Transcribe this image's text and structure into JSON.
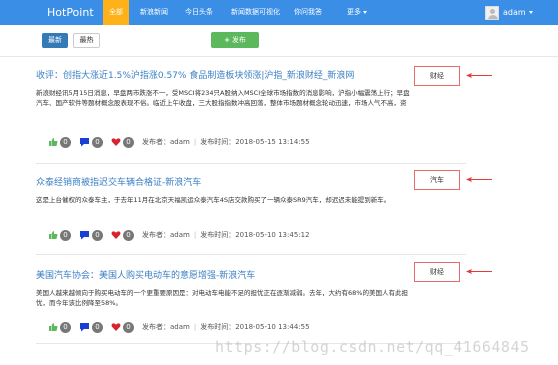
{
  "navbar": {
    "brand": "HotPoint",
    "items": [
      {
        "label": "全部",
        "active": true
      },
      {
        "label": "新浪新闻",
        "active": false
      },
      {
        "label": "今日头条",
        "active": false
      },
      {
        "label": "新闻数据可视化",
        "active": false
      },
      {
        "label": "你问我答",
        "active": false
      },
      {
        "label": "更多",
        "active": false
      }
    ],
    "user": "adam"
  },
  "toolbar": {
    "latest_label": "最新",
    "hottest_label": "最热",
    "publish_label": "发布"
  },
  "posts": [
    {
      "title": "收评：创指大涨近1.5%沪指涨0.57% 食品制造板块领涨|沪指_新浪财经_新浪网",
      "body": "新浪财经讯5月15日消息，早盘两市跌涨不一，受MSCI将234只A股纳入MSCI全球市场指数的消息影响，沪指小幅震荡上行；早盘汽车、国产软件等题材概念股表现不俗。临近上午收盘，三大股指指数冲高回落，整体市场题材概念轮动迅速，市场人气不高，资",
      "likes": "0",
      "comments": "0",
      "hearts": "0",
      "author": "发布者：adam",
      "time": "发布时间：2018-05-15 13:14:55",
      "tag": "财经"
    },
    {
      "title": "众泰经销商被指迟交车辆合格证-新浪汽车",
      "body": "这是上台催权的众泰车主，于去年11月在北京天福凯运众泰汽车4S店交款购买了一辆众泰SR9汽车，却迟迟未能提到新车。",
      "likes": "0",
      "comments": "0",
      "hearts": "0",
      "author": "发布者：adam",
      "time": "发布时间：2018-05-10 13:45:12",
      "tag": "汽车"
    },
    {
      "title": "美国汽车协会：美国人购买电动车的意愿增强-新浪汽车",
      "body": "美国人越来越倾向于购买电动车的一个更重要原因是：对电动车电能不足的担忧正在逐渐减弱。去年，大约有68%的美国人有此担忧，而今年该比例降至58%。",
      "likes": "0",
      "comments": "0",
      "hearts": "0",
      "author": "发布者：adam",
      "time": "发布时间：2018-05-10 13:44:55",
      "tag": "财经"
    }
  ],
  "watermark": "https://blog.csdn.net/qq_41664845",
  "colors": {
    "navbar": "#3a8ee6",
    "active_tab": "#ffb11a",
    "primary_button": "#337ab7",
    "success_button": "#5cb85c",
    "link": "#3b7fc4",
    "annotation": "#e56a6a"
  }
}
